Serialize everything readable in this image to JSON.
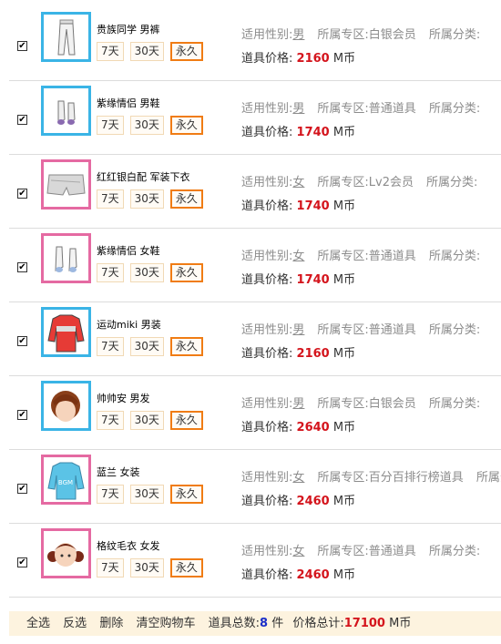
{
  "items": [
    {
      "checked": true,
      "name": "贵族同学  男裤",
      "gender": "男",
      "zone": "白银会员",
      "price": "2160",
      "thumb": "pants",
      "border": "blue"
    },
    {
      "checked": true,
      "name": "紫缘情侣  男鞋",
      "gender": "男",
      "zone": "普通道具",
      "price": "1740",
      "thumb": "shoes-m",
      "border": "blue"
    },
    {
      "checked": true,
      "name": "红红银白配  军装下衣",
      "gender": "女",
      "zone": "Lv2会员",
      "price": "1740",
      "thumb": "shorts",
      "border": "pink"
    },
    {
      "checked": true,
      "name": "紫缘情侣  女鞋",
      "gender": "女",
      "zone": "普通道具",
      "price": "1740",
      "thumb": "shoes-f",
      "border": "pink"
    },
    {
      "checked": true,
      "name": "运动miki 男装",
      "gender": "男",
      "zone": "普通道具",
      "price": "2160",
      "thumb": "shirt-red",
      "border": "blue"
    },
    {
      "checked": true,
      "name": "帅帅安  男发",
      "gender": "男",
      "zone": "白银会员",
      "price": "2640",
      "thumb": "hair-m",
      "border": "blue"
    },
    {
      "checked": true,
      "name": "蓝兰  女装",
      "gender": "女",
      "zone": "百分百排行榜道具",
      "price": "2460",
      "thumb": "shirt-blue",
      "border": "pink"
    },
    {
      "checked": true,
      "name": "格纹毛衣  女发",
      "gender": "女",
      "zone": "普通道具",
      "price": "2460",
      "thumb": "hair-f",
      "border": "pink"
    }
  ],
  "labels": {
    "gender": "适用性别:",
    "zone": "所属专区:",
    "category": "所属分类:",
    "price": "道具价格:",
    "currency": "M币",
    "checkmark": "✔"
  },
  "durations": [
    "7天",
    "30天",
    "永久"
  ],
  "footer": {
    "select_all": "全选",
    "invert": "反选",
    "delete": "删除",
    "clear_cart": "清空购物车",
    "count_label": "道具总数:",
    "count": "8",
    "count_unit": "件",
    "total_label": "价格总计:",
    "total": "17100",
    "currency": "M币"
  },
  "colors": {
    "blue_border": "#3ab4e6",
    "pink_border": "#e56aa2",
    "price": "#d4141c",
    "selected": "#f07c14"
  }
}
